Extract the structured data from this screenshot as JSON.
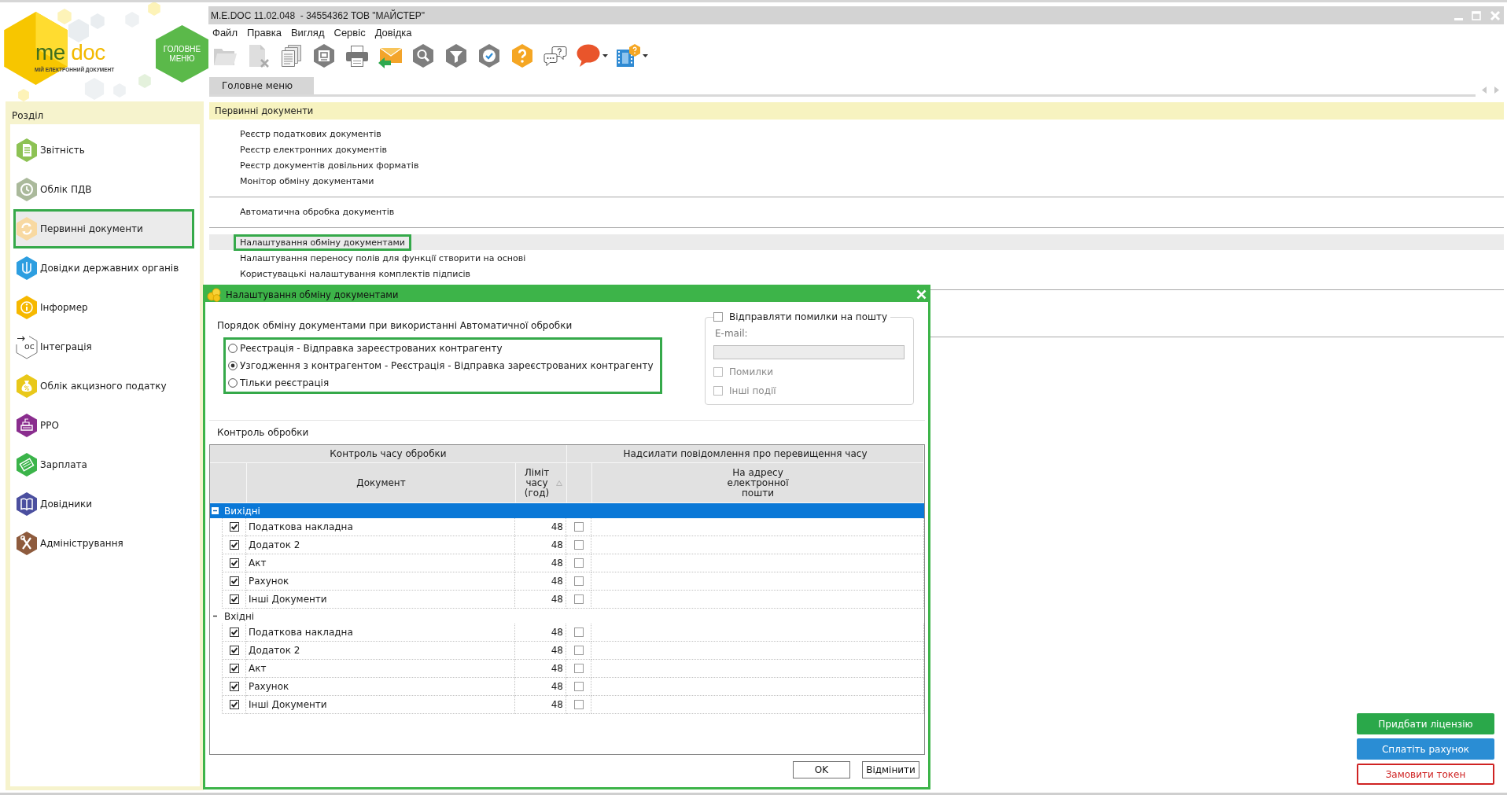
{
  "logo": {
    "wordmark": [
      "me",
      "doc"
    ],
    "tagline": "МІЙ ЕЛЕКТРОННИЙ ДОКУМЕНТ"
  },
  "main_menu_button": {
    "label": "ГОЛОВНЕ МЕНЮ"
  },
  "window": {
    "title": "M.E.DOC 11.02.048  - 34554362 ТОВ \"МАЙСТЕР\""
  },
  "menu_bar": [
    "Файл",
    "Правка",
    "Вигляд",
    "Сервіс",
    "Довідка"
  ],
  "toolbar": [
    {
      "kind": "open-folder",
      "disabled": true,
      "dropdown": false
    },
    {
      "kind": "delete-document",
      "disabled": true,
      "dropdown": false
    },
    {
      "kind": "copy-pages",
      "disabled": false,
      "dropdown": false
    },
    {
      "kind": "safe",
      "disabled": false,
      "dropdown": false
    },
    {
      "kind": "print",
      "disabled": false,
      "dropdown": false
    },
    {
      "kind": "send",
      "disabled": false,
      "dropdown": false
    },
    {
      "kind": "search",
      "disabled": false,
      "dropdown": false
    },
    {
      "kind": "filter",
      "disabled": false,
      "dropdown": false
    },
    {
      "kind": "verify",
      "disabled": false,
      "dropdown": false
    },
    {
      "kind": "help",
      "disabled": false,
      "dropdown": false
    },
    {
      "kind": "chat",
      "disabled": false,
      "dropdown": false
    },
    {
      "kind": "message",
      "disabled": false,
      "dropdown": true
    },
    {
      "kind": "video-help",
      "disabled": false,
      "dropdown": true
    }
  ],
  "tabs": [
    {
      "label": "Головне меню",
      "selected": true
    }
  ],
  "sidebar": {
    "title": "Розділ",
    "items": [
      {
        "label": "Звітність",
        "kind": "reports",
        "selected": false,
        "highlighted": false
      },
      {
        "label": "Облік ПДВ",
        "kind": "vat",
        "selected": false,
        "highlighted": false
      },
      {
        "label": "Первинні документи",
        "kind": "primary",
        "selected": true,
        "highlighted": true
      },
      {
        "label": "Довідки державних органів",
        "kind": "gov",
        "selected": false,
        "highlighted": false
      },
      {
        "label": "Інформер",
        "kind": "informer",
        "selected": false,
        "highlighted": false
      },
      {
        "label": "Інтеграція",
        "kind": "integration",
        "icon_text": "oc",
        "selected": false,
        "highlighted": false
      },
      {
        "label": "Облік акцизного податку",
        "kind": "excise",
        "selected": false,
        "highlighted": false
      },
      {
        "label": "РРО",
        "kind": "rro",
        "selected": false,
        "highlighted": false
      },
      {
        "label": "Зарплата",
        "kind": "salary",
        "selected": false,
        "highlighted": false
      },
      {
        "label": "Довідники",
        "kind": "directories",
        "selected": false,
        "highlighted": false
      },
      {
        "label": "Адміністрування",
        "kind": "admin",
        "selected": false,
        "highlighted": false
      }
    ]
  },
  "section": {
    "title": "Первинні документи",
    "groups": [
      {
        "items": [
          {
            "label": "Реєстр податкових документів",
            "selected": false,
            "highlighted": false
          },
          {
            "label": "Реєстр електронних документів",
            "selected": false,
            "highlighted": false
          },
          {
            "label": "Реєстр документів довільних форматів",
            "selected": false,
            "highlighted": false
          },
          {
            "label": "Монітор обміну документами",
            "selected": false,
            "highlighted": false
          }
        ]
      },
      {
        "items": [
          {
            "label": "Автоматична обробка документів",
            "selected": false,
            "highlighted": false
          }
        ]
      },
      {
        "items": [
          {
            "label": "Налаштування обміну документами",
            "selected": true,
            "highlighted": true
          },
          {
            "label": "Налаштування переносу полів для функції створити на основі",
            "selected": false,
            "highlighted": false
          },
          {
            "label": "Користувацькі налаштування комплектів підписів",
            "selected": false,
            "highlighted": false
          }
        ]
      }
    ]
  },
  "dialog": {
    "title": "Налаштування обміну документами",
    "exchange_order": {
      "label": "Порядок обміну документами при використанні Автоматичної обробки",
      "highlighted": true,
      "options": [
        {
          "label": "Реєстрація - Відправка зареєстрованих контрагенту",
          "selected": false
        },
        {
          "label": "Узгодження з контрагентом - Реєстрація - Відправка зареєстрованих контрагенту",
          "selected": true
        },
        {
          "label": "Тільки реєстрація",
          "selected": false
        }
      ]
    },
    "error_mail": {
      "label": "Відправляти помилки на пошту",
      "checked": false,
      "email_label": "E-mail:",
      "email_field": {
        "disabled": true
      },
      "options": [
        {
          "label": "Помилки",
          "checked": false,
          "disabled": true
        },
        {
          "label": "Інші події",
          "checked": false,
          "disabled": true
        }
      ]
    },
    "processing_control": {
      "label": "Контроль обробки",
      "table": {
        "column_groups": [
          {
            "label": "Контроль часу обробки"
          },
          {
            "label": "Надсилати повідомлення про перевищення часу"
          }
        ],
        "columns": [
          {
            "label": "Документ"
          },
          {
            "label": "Ліміт часу (год)",
            "sorted": true
          },
          {
            "label": "На адресу електронної пошти"
          }
        ],
        "groups": [
          {
            "label": "Вихідні",
            "expanded": true,
            "selected": true,
            "rows": [
              {
                "enabled": true,
                "document": "Податкова накладна",
                "limit": "48",
                "notify": false
              },
              {
                "enabled": true,
                "document": "Додаток 2",
                "limit": "48",
                "notify": false
              },
              {
                "enabled": true,
                "document": "Акт",
                "limit": "48",
                "notify": false
              },
              {
                "enabled": true,
                "document": "Рахунок",
                "limit": "48",
                "notify": false
              },
              {
                "enabled": true,
                "document": "Інші Документи",
                "limit": "48",
                "notify": false
              }
            ]
          },
          {
            "label": "Вхідні",
            "expanded": true,
            "selected": false,
            "rows": [
              {
                "enabled": true,
                "document": "Податкова накладна",
                "limit": "48",
                "notify": false
              },
              {
                "enabled": true,
                "document": "Додаток 2",
                "limit": "48",
                "notify": false
              },
              {
                "enabled": true,
                "document": "Акт",
                "limit": "48",
                "notify": false
              },
              {
                "enabled": true,
                "document": "Рахунок",
                "limit": "48",
                "notify": false
              },
              {
                "enabled": true,
                "document": "Інші Документи",
                "limit": "48",
                "notify": false
              }
            ]
          }
        ]
      }
    },
    "buttons": [
      "OK",
      "Відмінити"
    ]
  },
  "promo_buttons": [
    {
      "label": "Придбати ліцензію",
      "kind": "buy"
    },
    {
      "label": "Сплатіть рахунок",
      "kind": "pay"
    },
    {
      "label": "Замовити токен",
      "kind": "order"
    }
  ]
}
